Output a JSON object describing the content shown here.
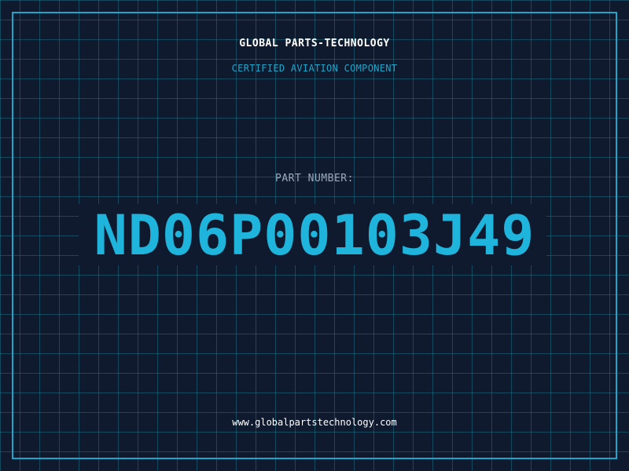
{
  "label": {
    "company": "GLOBAL PARTS-TECHNOLOGY",
    "tagline": "CERTIFIED AVIATION COMPONENT",
    "part_number_label": "PART NUMBER:",
    "part_number": "ND06P00103J49",
    "website": "www.globalpartstechnology.com"
  },
  "colors": {
    "background": "#101a2e",
    "grid": "#188096",
    "accent": "#1ea5c9",
    "part_number": "#1eb4dc",
    "text_primary": "#ffffff",
    "text_muted": "#9aa8bc"
  }
}
